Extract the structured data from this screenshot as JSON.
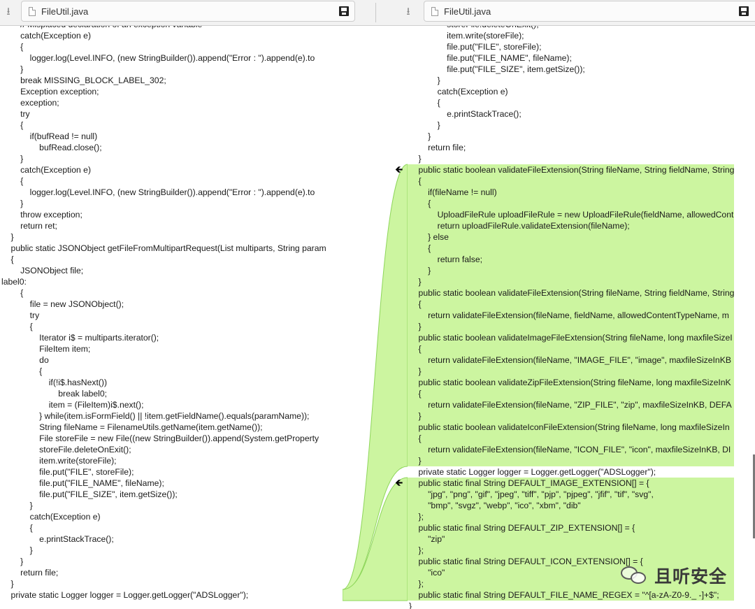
{
  "tabs": {
    "left": {
      "title": "FileUtil.java"
    },
    "right": {
      "title": "FileUtil.java"
    }
  },
  "colors": {
    "added": "#ccf5a0",
    "added_border": "#8ed65a"
  },
  "icons": {
    "download": "download-icon",
    "save": "save-icon",
    "file": "file-icon",
    "arrow": "left-arrow-icon"
  },
  "left_lines": [
    "        // Misplaced declaration of an exception variable",
    "        catch(Exception e)",
    "        {",
    "            logger.log(Level.INFO, (new StringBuilder()).append(\"Error : \").append(e).to",
    "        }",
    "        break MISSING_BLOCK_LABEL_302;",
    "        Exception exception;",
    "        exception;",
    "        try",
    "        {",
    "            if(bufRead != null)",
    "                bufRead.close();",
    "        }",
    "        catch(Exception e)",
    "        {",
    "            logger.log(Level.INFO, (new StringBuilder()).append(\"Error : \").append(e).to",
    "        }",
    "        throw exception;",
    "        return ret;",
    "    }",
    "    public static JSONObject getFileFromMultipartRequest(List multiparts, String param",
    "    {",
    "        JSONObject file;",
    "label0:",
    "        {",
    "            file = new JSONObject();",
    "            try",
    "            {",
    "                Iterator i$ = multiparts.iterator();",
    "                FileItem item;",
    "                do",
    "                {",
    "                    if(!i$.hasNext())",
    "                        break label0;",
    "                    item = (FileItem)i$.next();",
    "                } while(item.isFormField() || !item.getFieldName().equals(paramName));",
    "                String fileName = FilenameUtils.getName(item.getName());",
    "                File storeFile = new File((new StringBuilder()).append(System.getProperty",
    "                storeFile.deleteOnExit();",
    "                item.write(storeFile);",
    "                file.put(\"FILE\", storeFile);",
    "                file.put(\"FILE_NAME\", fileName);",
    "                file.put(\"FILE_SIZE\", item.getSize());",
    "            }",
    "            catch(Exception e)",
    "            {",
    "                e.printStackTrace();",
    "            }",
    "        }",
    "        return file;",
    "    }",
    "    private static Logger logger = Logger.getLogger(\"ADSLogger\");"
  ],
  "right_lines": [
    "                storeFile.deleteOnExit();",
    "                item.write(storeFile);",
    "                file.put(\"FILE\", storeFile);",
    "                file.put(\"FILE_NAME\", fileName);",
    "                file.put(\"FILE_SIZE\", item.getSize());",
    "            }",
    "            catch(Exception e)",
    "            {",
    "                e.printStackTrace();",
    "            }",
    "        }",
    "        return file;",
    "    }",
    "    public static boolean validateFileExtension(String fileName, String fieldName, String",
    "    {",
    "        if(fileName != null)",
    "        {",
    "            UploadFileRule uploadFileRule = new UploadFileRule(fieldName, allowedCont",
    "            return uploadFileRule.validateExtension(fileName);",
    "        } else",
    "        {",
    "            return false;",
    "        }",
    "    }",
    "    public static boolean validateFileExtension(String fileName, String fieldName, String",
    "    {",
    "        return validateFileExtension(fileName, fieldName, allowedContentTypeName, m",
    "    }",
    "    public static boolean validateImageFileExtension(String fileName, long maxfileSizeI",
    "    {",
    "        return validateFileExtension(fileName, \"IMAGE_FILE\", \"image\", maxfileSizeInKB",
    "    }",
    "    public static boolean validateZipFileExtension(String fileName, long maxfileSizeInK",
    "    {",
    "        return validateFileExtension(fileName, \"ZIP_FILE\", \"zip\", maxfileSizeInKB, DEFA",
    "    }",
    "    public static boolean validateIconFileExtension(String fileName, long maxfileSizeIn",
    "    {",
    "        return validateFileExtension(fileName, \"ICON_FILE\", \"icon\", maxfileSizeInKB, DI",
    "    }",
    "    private static Logger logger = Logger.getLogger(\"ADSLogger\");",
    "    public static final String DEFAULT_IMAGE_EXTENSION[] = {",
    "        \"jpg\", \"png\", \"gif\", \"jpeg\", \"tiff\", \"pjp\", \"pjpeg\", \"jfif\", \"tif\", \"svg\",",
    "        \"bmp\", \"svgz\", \"webp\", \"ico\", \"xbm\", \"dib\"",
    "    };",
    "    public static final String DEFAULT_ZIP_EXTENSION[] = {",
    "        \"zip\"",
    "    };",
    "    public static final String DEFAULT_ICON_EXTENSION[] = {",
    "        \"ico\"",
    "    };",
    "    public static final String DEFAULT_FILE_NAME_REGEX = \"^[a-zA-Z0-9._ -]+$\";",
    "}"
  ],
  "watermark": {
    "text": "且听安全"
  }
}
